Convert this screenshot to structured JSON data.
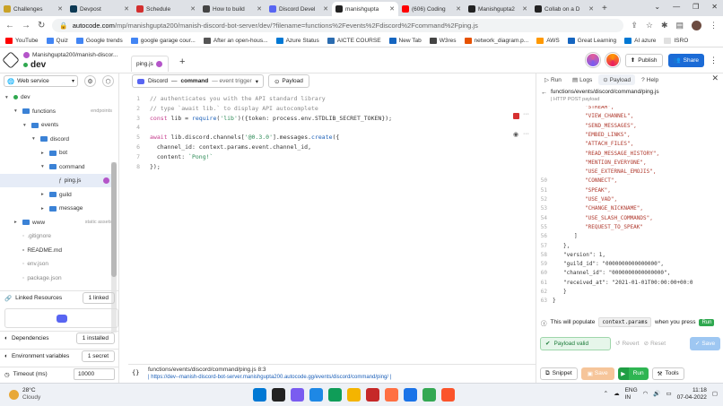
{
  "browser": {
    "tabs": [
      {
        "label": "Challenges",
        "color": "#c9a227",
        "active": false
      },
      {
        "label": "Devpost",
        "color": "#0d3954",
        "active": false
      },
      {
        "label": "Schedule",
        "color": "#d32f2f",
        "active": false
      },
      {
        "label": "How to build",
        "color": "#444444",
        "active": false
      },
      {
        "label": "Discord Devel",
        "color": "#5865f2",
        "active": false
      },
      {
        "label": "manishgupta",
        "color": "#222222",
        "active": true
      },
      {
        "label": "(606) Coding",
        "color": "#ff0000",
        "active": false
      },
      {
        "label": "Manishgupta2",
        "color": "#222222",
        "active": false
      },
      {
        "label": "Collab on a D",
        "color": "#222222",
        "active": false
      }
    ],
    "url_host": "autocode.com",
    "url_path": "/mp/manishgupta200/manish-discord-bot-server/dev/?filename=functions%2Fevents%2Fdiscord%2Fcommand%2Fping.js",
    "bookmarks": [
      {
        "label": "YouTube",
        "color": "#ff0000"
      },
      {
        "label": "Quiz",
        "color": "#4285f4"
      },
      {
        "label": "Google trends",
        "color": "#4285f4"
      },
      {
        "label": "google garage cour...",
        "color": "#4285f4"
      },
      {
        "label": "After an open-hous...",
        "color": "#555555"
      },
      {
        "label": "Azure Status",
        "color": "#0078d4"
      },
      {
        "label": "AICTE COURSE",
        "color": "#2b6cb0"
      },
      {
        "label": "New Tab",
        "color": "#1565c0"
      },
      {
        "label": "W3res",
        "color": "#444444"
      },
      {
        "label": "network_diagram.p...",
        "color": "#e65100"
      },
      {
        "label": "AWS",
        "color": "#ff9900"
      },
      {
        "label": "Great Learning",
        "color": "#1565c0"
      },
      {
        "label": "AI azure",
        "color": "#0078d4"
      },
      {
        "label": "ISRO",
        "color": "#e0e0e0"
      }
    ]
  },
  "app": {
    "project_path": "Manishgupta200/manish-discor...",
    "env": "dev",
    "open_file_tab": "ping.js",
    "publish_label": "Publish",
    "share_label": "Share"
  },
  "sidebar": {
    "service": "Web service",
    "tree": [
      {
        "label": "dev",
        "depth": 0,
        "kind": "env",
        "meta": ""
      },
      {
        "label": "functions",
        "depth": 1,
        "kind": "folder",
        "meta": "endpoints"
      },
      {
        "label": "events",
        "depth": 2,
        "kind": "folder",
        "meta": ""
      },
      {
        "label": "discord",
        "depth": 3,
        "kind": "folder",
        "meta": ""
      },
      {
        "label": "bot",
        "depth": 4,
        "kind": "folder",
        "meta": ""
      },
      {
        "label": "command",
        "depth": 4,
        "kind": "folder",
        "meta": ""
      },
      {
        "label": "ping.js",
        "depth": 5,
        "kind": "file",
        "meta": "",
        "selected": true
      },
      {
        "label": "guild",
        "depth": 4,
        "kind": "folder",
        "meta": ""
      },
      {
        "label": "message",
        "depth": 4,
        "kind": "folder",
        "meta": ""
      },
      {
        "label": "www",
        "depth": 1,
        "kind": "folder",
        "meta": "static assets"
      },
      {
        "label": ".gitignore",
        "depth": 1,
        "kind": "dimfile",
        "meta": ""
      },
      {
        "label": "README.md",
        "depth": 1,
        "kind": "file",
        "meta": ""
      },
      {
        "label": "env.json",
        "depth": 1,
        "kind": "dimfile",
        "meta": ""
      },
      {
        "label": "package.json",
        "depth": 1,
        "kind": "dimfile",
        "meta": ""
      }
    ],
    "linked_resources_label": "Linked Resources",
    "linked_count": "1 linked",
    "dependencies_label": "Dependencies",
    "dependencies_count": "1 installed",
    "env_vars_label": "Environment variables",
    "env_vars_count": "1 secret",
    "timeout_label": "Timeout (ms)",
    "timeout_value": "10000"
  },
  "editor": {
    "endpoint_prefix": "Discord",
    "endpoint_event": "command",
    "endpoint_suffix": "— event trigger",
    "payload_label": "Payload",
    "lines": [
      {
        "n": "1",
        "html": "<span class=\"c-cm\">// authenticates you with the API standard library</span>"
      },
      {
        "n": "2",
        "html": "<span class=\"c-cm\">// type `await lib.` to display API autocomplete</span>"
      },
      {
        "n": "3",
        "html": "<span class=\"c-kw\">const</span> lib = <span class=\"c-fn\">require</span>(<span class=\"c-str\">'lib'</span>)({token: process.env.STDLIB_SECRET_TOKEN});"
      },
      {
        "n": "4",
        "html": ""
      },
      {
        "n": "5",
        "html": "<span class=\"c-kw\">await</span> lib.discord.channels[<span class=\"c-str\">'@0.3.0'</span>].messages.<span class=\"c-fn\">create</span>({"
      },
      {
        "n": "6",
        "html": "  channel_id: context.params.event.channel_id,"
      },
      {
        "n": "7",
        "html": "  content: <span class=\"c-str\">`Pong!`</span>"
      },
      {
        "n": "8",
        "html": "});"
      }
    ]
  },
  "right_panel": {
    "tabs": [
      {
        "label": "Run",
        "active": false
      },
      {
        "label": "Logs",
        "active": false
      },
      {
        "label": "Payload",
        "active": true
      },
      {
        "label": "Help",
        "active": false
      }
    ],
    "path": "functions/events/discord/command/ping.js",
    "method": "| HTTP POST payload",
    "json_lines": [
      {
        "n": "",
        "text": "\"STREAM\","
      },
      {
        "n": "",
        "text": "\"VIEW_CHANNEL\","
      },
      {
        "n": "",
        "text": "\"SEND_MESSAGES\","
      },
      {
        "n": "",
        "text": "\"EMBED_LINKS\","
      },
      {
        "n": "",
        "text": "\"ATTACH_FILES\","
      },
      {
        "n": "",
        "text": "\"READ_MESSAGE_HISTORY\","
      },
      {
        "n": "",
        "text": "\"MENTION_EVERYONE\","
      },
      {
        "n": "",
        "text": "\"USE_EXTERNAL_EMOJIS\","
      },
      {
        "n": "50",
        "text": "\"CONNECT\","
      },
      {
        "n": "51",
        "text": "\"SPEAK\","
      },
      {
        "n": "52",
        "text": "\"USE_VAD\","
      },
      {
        "n": "53",
        "text": "\"CHANGE_NICKNAME\","
      },
      {
        "n": "54",
        "text": "\"USE_SLASH_COMMANDS\","
      },
      {
        "n": "55",
        "text": "\"REQUEST_TO_SPEAK\""
      },
      {
        "n": "56",
        "text": "]"
      },
      {
        "n": "57",
        "text": "},"
      },
      {
        "n": "58",
        "text": "\"version\": 1,"
      },
      {
        "n": "59",
        "text": "\"guild_id\": \"0000000000000000\","
      },
      {
        "n": "60",
        "text": "\"channel_id\": \"0000000000000000\","
      },
      {
        "n": "61",
        "text": "\"received_at\": \"2021-01-01T00:00:00+00:0"
      },
      {
        "n": "62",
        "text": "}"
      },
      {
        "n": "63",
        "text": "}"
      }
    ],
    "context_pre": "This will populate",
    "context_code": "context.params",
    "context_mid": "when you press",
    "context_run": "Run",
    "valid_label": "Payload valid",
    "revert_label": "Revert",
    "reset_label": "Reset",
    "save_label": "Save"
  },
  "statusbar": {
    "file": "functions/events/discord/command/ping.js",
    "cursor": "8:3",
    "url": "| https://dev--manish-discord-bot-server.manishgupta200.autocode.gg/events/discord/command/ping/ |",
    "snippet_label": "Snippet",
    "save_label": "Save",
    "run_label": "Run",
    "tools_label": "Tools"
  },
  "taskbar": {
    "temp": "28°C",
    "weather": "Cloudy",
    "lang1": "ENG",
    "lang2": "IN",
    "time": "11:18",
    "date": "07-04-2022",
    "icons": [
      "#0078d4",
      "#222222",
      "#7a5cf0",
      "#1e88e5",
      "#0f9d58",
      "#f4b400",
      "#c62828",
      "#ff7043",
      "#1a73e8",
      "#34a853",
      "#fb542b"
    ]
  }
}
